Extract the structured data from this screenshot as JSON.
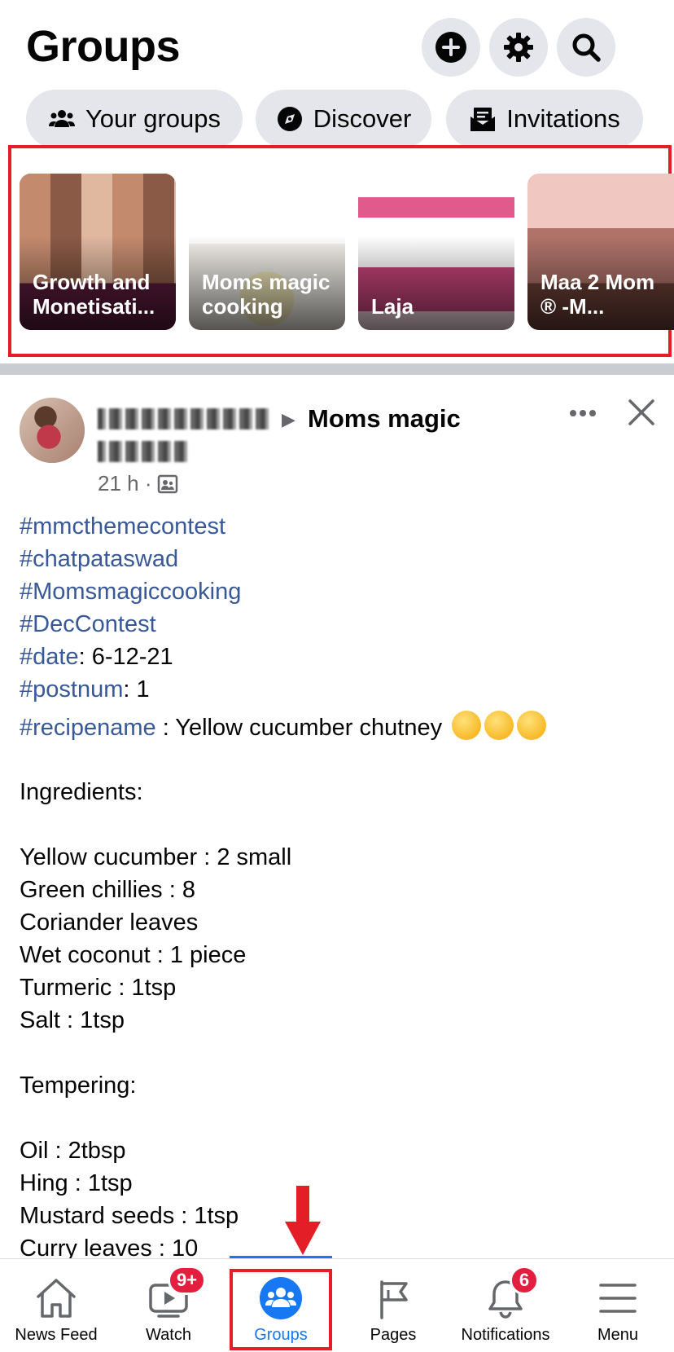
{
  "header": {
    "title": "Groups",
    "icons": [
      "plus-icon",
      "gear-icon",
      "search-icon"
    ]
  },
  "tabs": [
    {
      "label": "Your groups",
      "icon": "people-icon"
    },
    {
      "label": "Discover",
      "icon": "compass-icon"
    },
    {
      "label": "Invitations",
      "icon": "envelope-icon"
    }
  ],
  "groups": [
    {
      "name": "Growth and Monetisati..."
    },
    {
      "name": "Moms magic cooking"
    },
    {
      "name": "Laja"
    },
    {
      "name": "Maa 2 Mom ® -M..."
    }
  ],
  "post": {
    "group": "Moms magic",
    "time": "21 h ·",
    "lines": [
      {
        "tag": "#mmcthemecontest",
        "text": ""
      },
      {
        "tag": "#chatpataswad",
        "text": ""
      },
      {
        "tag": "#Momsmagiccooking",
        "text": ""
      },
      {
        "tag": "#DecContest",
        "text": ""
      },
      {
        "tag": "#date",
        "text": ": 6-12-21"
      },
      {
        "tag": "#postnum",
        "text": ": 1"
      },
      {
        "tag": "#recipename",
        "text": " : Yellow cucumber chutney"
      }
    ],
    "ingredients_heading": "Ingredients:",
    "ingredients": [
      "Yellow cucumber : 2 small",
      "Green chillies : 8",
      "Coriander leaves",
      "Wet coconut : 1 piece",
      "Turmeric : 1tsp",
      "Salt : 1tsp"
    ],
    "tempering_heading": "Tempering:",
    "tempering": [
      "Oil : 2tbsp",
      "Hing : 1tsp",
      "Mustard seeds : 1tsp",
      "Curry leaves : 10"
    ]
  },
  "nav": [
    {
      "label": "News Feed",
      "icon": "home-icon"
    },
    {
      "label": "Watch",
      "icon": "video-icon",
      "badge": "9+"
    },
    {
      "label": "Groups",
      "icon": "groups-icon"
    },
    {
      "label": "Pages",
      "icon": "flag-icon"
    },
    {
      "label": "Notifications",
      "icon": "bell-icon",
      "badge": "6"
    },
    {
      "label": "Menu",
      "icon": "hamburger-icon"
    }
  ],
  "colors": {
    "accent": "#1877f2",
    "hashtag": "#385898",
    "highlight": "#e41e26"
  }
}
